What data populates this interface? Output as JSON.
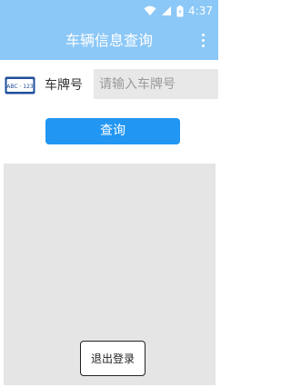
{
  "status_bar": {
    "time": "4:37",
    "icons": [
      "wifi-icon",
      "signal-icon",
      "battery-icon"
    ]
  },
  "app_bar": {
    "title": "车辆信息查询",
    "menu_icon": "more-vert-icon"
  },
  "plate_row": {
    "icon_text": "ABC · 123",
    "label": "车牌号",
    "input_value": "",
    "input_placeholder": "请输入车牌号"
  },
  "query_button": {
    "label": "查询"
  },
  "logout_button": {
    "label": "退出登录"
  },
  "colors": {
    "app_bar": "#8cc8f7",
    "primary_button": "#2196f3",
    "result_area": "#e5e5e5"
  }
}
